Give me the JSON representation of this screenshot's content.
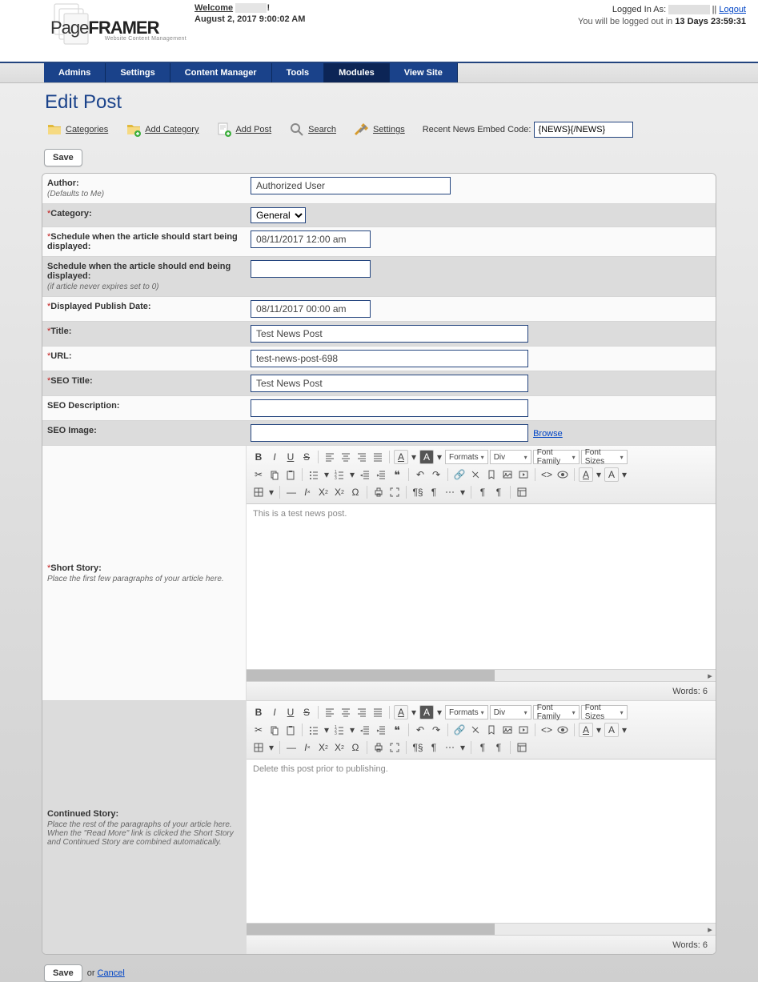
{
  "header": {
    "logo_main": "PageFRAMER",
    "logo_sub": "Website Content Management",
    "welcome_label": "Welcome",
    "welcome_exclaim": "!",
    "date_line": "August 2, 2017 9:00:02 AM",
    "logged_in_as_prefix": "Logged In As: ",
    "sep": " || ",
    "logout": "Logout",
    "logout_warn_prefix": "You will be logged out in ",
    "logout_warn_bold": "13 Days 23:59:31"
  },
  "nav": {
    "tabs": [
      "Admins",
      "Settings",
      "Content Manager",
      "Tools",
      "Modules",
      "View Site"
    ],
    "active_index": 4
  },
  "page": {
    "title": "Edit Post"
  },
  "toolbar": {
    "categories": "Categories",
    "add_category": "Add Category",
    "add_post": "Add Post",
    "search": "Search",
    "settings": "Settings",
    "embed_label": "Recent News Embed Code:",
    "embed_value": "{NEWS}{/NEWS}"
  },
  "buttons": {
    "save": "Save",
    "cancel": "Cancel",
    "or": "or "
  },
  "fields": {
    "author": {
      "label": "Author:",
      "sub": "(Defaults to Me)",
      "value": "Authorized User"
    },
    "category": {
      "label": "Category:",
      "value": "General"
    },
    "schedule_start": {
      "label": "Schedule when the article should start being displayed:",
      "value": "08/11/2017 12:00 am"
    },
    "schedule_end": {
      "label": "Schedule when the article should end being displayed:",
      "sub": "(if article never expires set to 0)",
      "value": ""
    },
    "publish_date": {
      "label": "Displayed Publish Date:",
      "value": "08/11/2017 00:00 am"
    },
    "title": {
      "label": "Title:",
      "value": "Test News Post"
    },
    "url": {
      "label": "URL:",
      "value": "test-news-post-698"
    },
    "seo_title": {
      "label": "SEO Title:",
      "value": "Test News Post"
    },
    "seo_desc": {
      "label": "SEO Description:",
      "value": ""
    },
    "seo_image": {
      "label": "SEO Image:",
      "value": "",
      "browse": "Browse"
    },
    "short_story": {
      "label": "Short Story:",
      "sub": "Place the first few paragraphs of your article here.",
      "content": "This is a test news post.",
      "words_label": "Words: 6"
    },
    "continued_story": {
      "label": "Continued Story:",
      "sub": "Place the rest of the paragraphs of your article here. When the \"Read More\" link is clicked the Short Story and Continued Story are combined automatically.",
      "content": "Delete this post prior to publishing.",
      "words_label": "Words: 6"
    }
  },
  "editor": {
    "formats": "Formats",
    "div": "Div",
    "font_family": "Font Family",
    "font_sizes": "Font Sizes"
  }
}
